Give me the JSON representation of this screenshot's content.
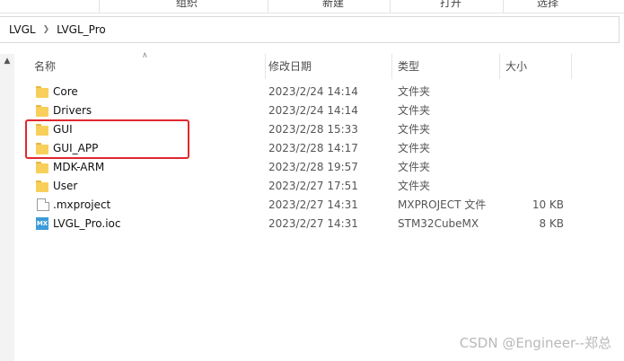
{
  "ribbon": {
    "groups": [
      "组织",
      "新建",
      "打开",
      "选择"
    ]
  },
  "address": {
    "crumbs": [
      "LVGL",
      "LVGL_Pro"
    ]
  },
  "columns": {
    "name": "名称",
    "date": "修改日期",
    "type": "类型",
    "size": "大小"
  },
  "files": [
    {
      "name": "Core",
      "date": "2023/2/24 14:14",
      "type": "文件夹",
      "size": "",
      "icon": "folder-icon"
    },
    {
      "name": "Drivers",
      "date": "2023/2/24 14:14",
      "type": "文件夹",
      "size": "",
      "icon": "folder-icon"
    },
    {
      "name": "GUI",
      "date": "2023/2/28 15:33",
      "type": "文件夹",
      "size": "",
      "icon": "folder-icon"
    },
    {
      "name": "GUI_APP",
      "date": "2023/2/28 14:17",
      "type": "文件夹",
      "size": "",
      "icon": "folder-icon"
    },
    {
      "name": "MDK-ARM",
      "date": "2023/2/28 19:57",
      "type": "文件夹",
      "size": "",
      "icon": "folder-icon"
    },
    {
      "name": "User",
      "date": "2023/2/27 17:51",
      "type": "文件夹",
      "size": "",
      "icon": "folder-icon"
    },
    {
      "name": ".mxproject",
      "date": "2023/2/27 14:31",
      "type": "MXPROJECT 文件",
      "size": "10 KB",
      "icon": "file-icon"
    },
    {
      "name": "LVGL_Pro.ioc",
      "date": "2023/2/27 14:31",
      "type": "STM32CubeMX",
      "size": "8 KB",
      "icon": "stm32cubemx-icon",
      "icon_text": "MX"
    }
  ],
  "highlight_color": "#e0282e",
  "watermark": "CSDN @Engineer--郑总"
}
